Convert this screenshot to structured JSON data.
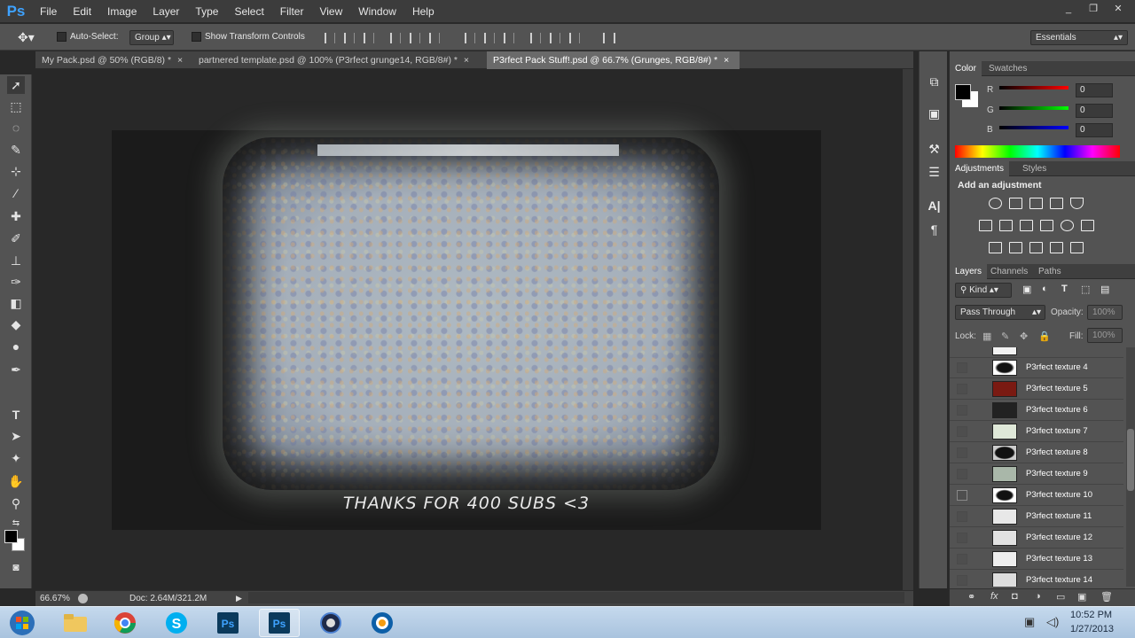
{
  "app": {
    "logo": "Ps"
  },
  "menu": [
    "File",
    "Edit",
    "Image",
    "Layer",
    "Type",
    "Select",
    "Filter",
    "View",
    "Window",
    "Help"
  ],
  "window_controls": [
    "_",
    "❐",
    "✕"
  ],
  "options": {
    "auto_select": "Auto-Select:",
    "group": "Group",
    "show_transform": "Show Transform Controls",
    "workspace": "Essentials"
  },
  "tabs": [
    {
      "label": "My Pack.psd @ 50% (RGB/8) *",
      "close": "×"
    },
    {
      "label": "partnered template.psd @ 100% (P3rfect grunge14, RGB/8#) *",
      "close": "×"
    },
    {
      "label": "P3rfect Pack Stuff!.psd @ 66.7% (Grunges, RGB/8#) *",
      "close": "×"
    }
  ],
  "canvas": {
    "caption": "THANKS FOR 400 SUBS <3"
  },
  "status": {
    "zoom": "66.67%",
    "doc": "Doc: 2.64M/321.2M"
  },
  "color_panel": {
    "tabs": [
      "Color",
      "Swatches"
    ],
    "channels": [
      {
        "label": "R",
        "value": "0"
      },
      {
        "label": "G",
        "value": "0"
      },
      {
        "label": "B",
        "value": "0"
      }
    ]
  },
  "adjustments": {
    "tabs": [
      "Adjustments",
      "Styles"
    ],
    "heading": "Add an adjustment"
  },
  "layers_panel": {
    "tabs": [
      "Layers",
      "Channels",
      "Paths"
    ],
    "filter": "Kind",
    "blend_mode": "Pass Through",
    "opacity_label": "Opacity:",
    "opacity": "100%",
    "lock_label": "Lock:",
    "fill_label": "Fill:",
    "fill": "100%",
    "layers": [
      {
        "name": "P3rfect texture 4",
        "visible": false
      },
      {
        "name": "P3rfect texture 5",
        "visible": false
      },
      {
        "name": "P3rfect texture 6",
        "visible": false
      },
      {
        "name": "P3rfect texture 7",
        "visible": false
      },
      {
        "name": "P3rfect texture 8",
        "visible": false
      },
      {
        "name": "P3rfect texture 9",
        "visible": false
      },
      {
        "name": "P3rfect texture 10",
        "visible": true
      },
      {
        "name": "P3rfect texture 11",
        "visible": false
      },
      {
        "name": "P3rfect texture 12",
        "visible": false
      },
      {
        "name": "P3rfect texture 13",
        "visible": false
      },
      {
        "name": "P3rfect texture 14",
        "visible": false
      }
    ]
  },
  "taskbar": {
    "time": "10:52 PM",
    "date": "1/27/2013"
  },
  "colors": {
    "accent": "#3ea2ff"
  }
}
